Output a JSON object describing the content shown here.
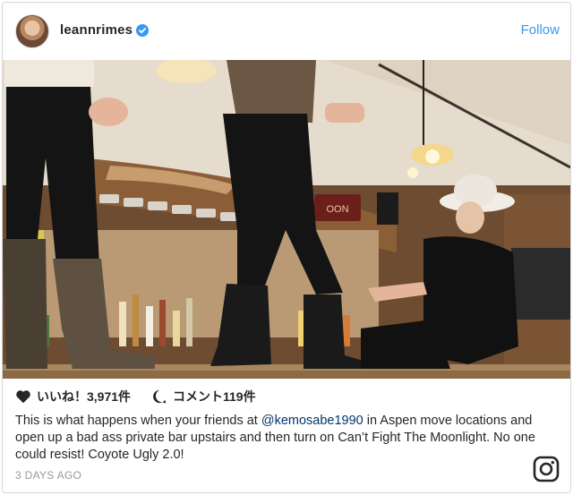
{
  "post": {
    "username": "leannrimes",
    "follow_label": "Follow",
    "likes_label": "いいね！3,971件",
    "comments_label": "コメント119件",
    "caption_prefix": "This is what happens when your friends at ",
    "caption_mention": "@kemosabe1990",
    "caption_suffix": " in Aspen move locations and open up a bad ass private bar upstairs and then turn on Can’t Fight The Moonlight. No one could resist! Coyote Ugly 2.0!",
    "timestamp": "3 DAYS AGO",
    "sign_text": "NO SABE ... OON"
  },
  "icons": {
    "verified": "verified-badge-icon",
    "like": "heart-icon",
    "comment": "comment-bubble-icon",
    "brand": "instagram-logo-icon"
  },
  "colors": {
    "accent": "#3897f0",
    "mention": "#003569",
    "text": "#262626",
    "muted": "#999999"
  }
}
